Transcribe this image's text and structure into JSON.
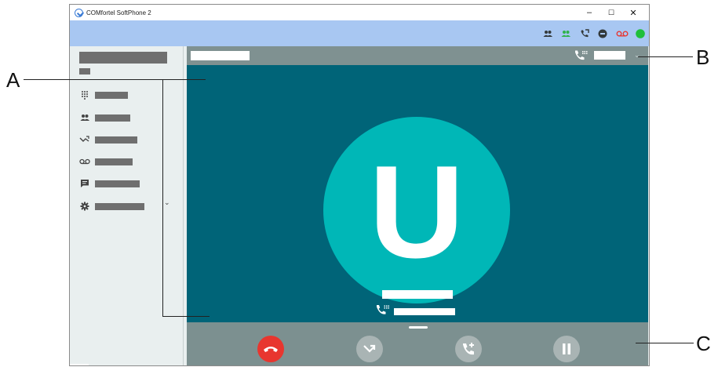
{
  "window": {
    "title": "COMfortel SoftPhone 2",
    "controls": {
      "minimize": "–",
      "maximize": "☐",
      "close": "✕"
    }
  },
  "toolbar": {
    "icons": [
      {
        "name": "contacts-icon",
        "glyph": "👥",
        "color": "#33393b"
      },
      {
        "name": "contacts-green-icon",
        "glyph": "👥",
        "color": "#2fb34a"
      },
      {
        "name": "call-forward-icon",
        "glyph": "☏",
        "color": "#33393b"
      },
      {
        "name": "do-not-disturb-icon",
        "glyph": "⊖",
        "color": "#33393b"
      },
      {
        "name": "voicemail-icon",
        "glyph": "oo",
        "color": "#e53935"
      },
      {
        "name": "presence-status-icon",
        "glyph": "●",
        "color": "#1fbf3a"
      }
    ]
  },
  "sidebar": {
    "nav_icons": [
      "dialpad-icon",
      "contacts-icon",
      "call-history-icon",
      "voicemail-icon",
      "messages-icon",
      "settings-icon"
    ],
    "expand_glyph": "⌄"
  },
  "call": {
    "avatar_letter": "U",
    "header_chevron": "⌄"
  },
  "callouts": {
    "a": "A",
    "b": "B",
    "c": "C"
  },
  "colors": {
    "call_background": "#006478",
    "avatar": "#00b7b7",
    "hangup": "#e8362f",
    "toolbar": "#a8c7f2"
  }
}
